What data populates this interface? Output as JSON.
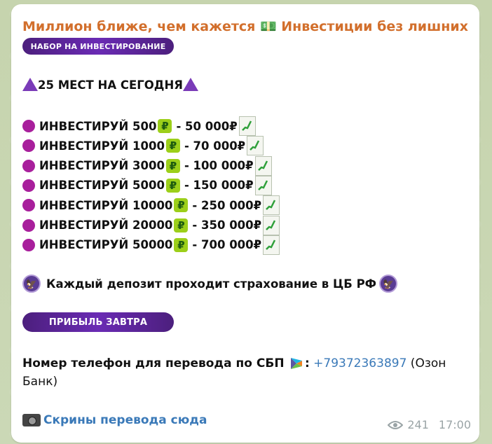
{
  "channel": {
    "title": "Миллион ближе, чем кажется 💵 Инвестиции без лишних р..."
  },
  "labels": {
    "pill_top": "НАБОР НА ИНВЕСТИРОВАНИЕ",
    "pill_bottom": "ПРИБЫЛЬ ЗАВТРА"
  },
  "headline": "25 МЕСТ НА СЕГОДНЯ",
  "invest_rows": [
    {
      "text": "ИНВЕСТИРУЙ 500",
      "result": "-  50 000₽"
    },
    {
      "text": "ИНВЕСТИРУЙ 1000",
      "result": "- 70 000₽"
    },
    {
      "text": "ИНВЕСТИРУЙ 3000",
      "result": "- 100 000₽"
    },
    {
      "text": "ИНВЕСТИРУЙ 5000",
      "result": "- 150 000₽"
    },
    {
      "text": "ИНВЕСТИРУЙ 10000",
      "result": "- 250 000₽"
    },
    {
      "text": "ИНВЕСТИРУЙ 20000",
      "result": "- 350 000₽"
    },
    {
      "text": "ИНВЕСТИРУЙ 50000",
      "result": "- 700 000₽"
    }
  ],
  "insurance": "Каждый депозит проходит страхование в ЦБ РФ",
  "phone": {
    "label": "Номер телефон для перевода по СБП",
    "colon": ":",
    "number": "+79372363897",
    "bank": " (Озон Банк)"
  },
  "screens_link": "Скрины перевода сюда",
  "meta": {
    "views": "241",
    "time": "17:00"
  },
  "colors": {
    "channel": "#d26f2c",
    "link": "#3a79b8",
    "pill": "#5a24a0",
    "dot": "#a81f9c"
  }
}
